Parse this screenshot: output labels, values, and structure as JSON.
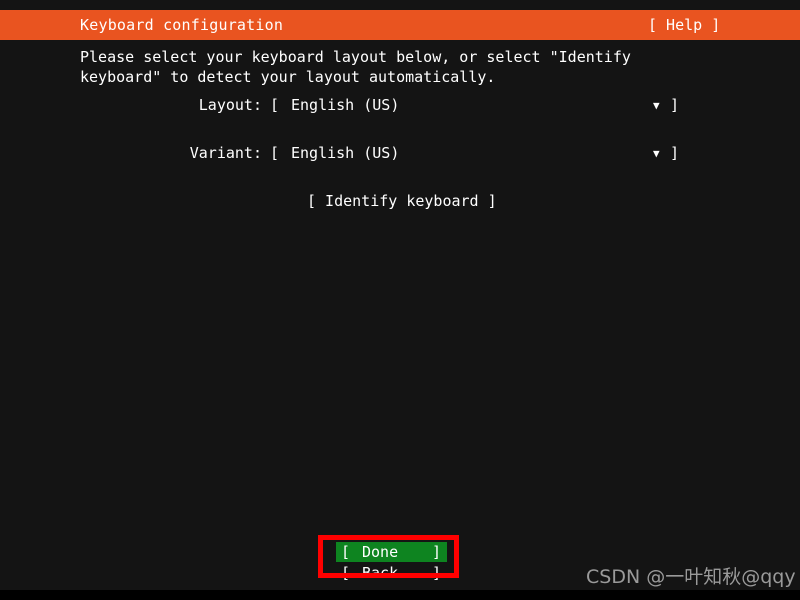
{
  "screen": {
    "background_color": "#141414",
    "text_color": "#ffffff"
  },
  "header": {
    "title": "Keyboard configuration",
    "help_label": "[ Help ]",
    "background_color": "#e95420"
  },
  "main": {
    "instructions": "Please select your keyboard layout below, or select \"Identify keyboard\" to detect your layout automatically.",
    "fields": [
      {
        "label": "Layout:",
        "bracket_open": "[",
        "value": "English (US)",
        "caret": "▼",
        "bracket_close": "]"
      },
      {
        "label": "Variant:",
        "bracket_open": "[",
        "value": "English (US)",
        "caret": "▼",
        "bracket_close": "]"
      }
    ],
    "identify_button": "[ Identify keyboard ]"
  },
  "footer": {
    "done": {
      "bracket_open": "[",
      "label": "Done",
      "bracket_close": "]",
      "background_color": "#0e8420",
      "focused": true,
      "focus_color": "#ff0000"
    },
    "back": {
      "bracket_open": "[",
      "label": "Back",
      "bracket_close": "]"
    }
  },
  "watermark": {
    "text": "CSDN @一叶知秋@qqy",
    "color": "#9a9a9a"
  }
}
